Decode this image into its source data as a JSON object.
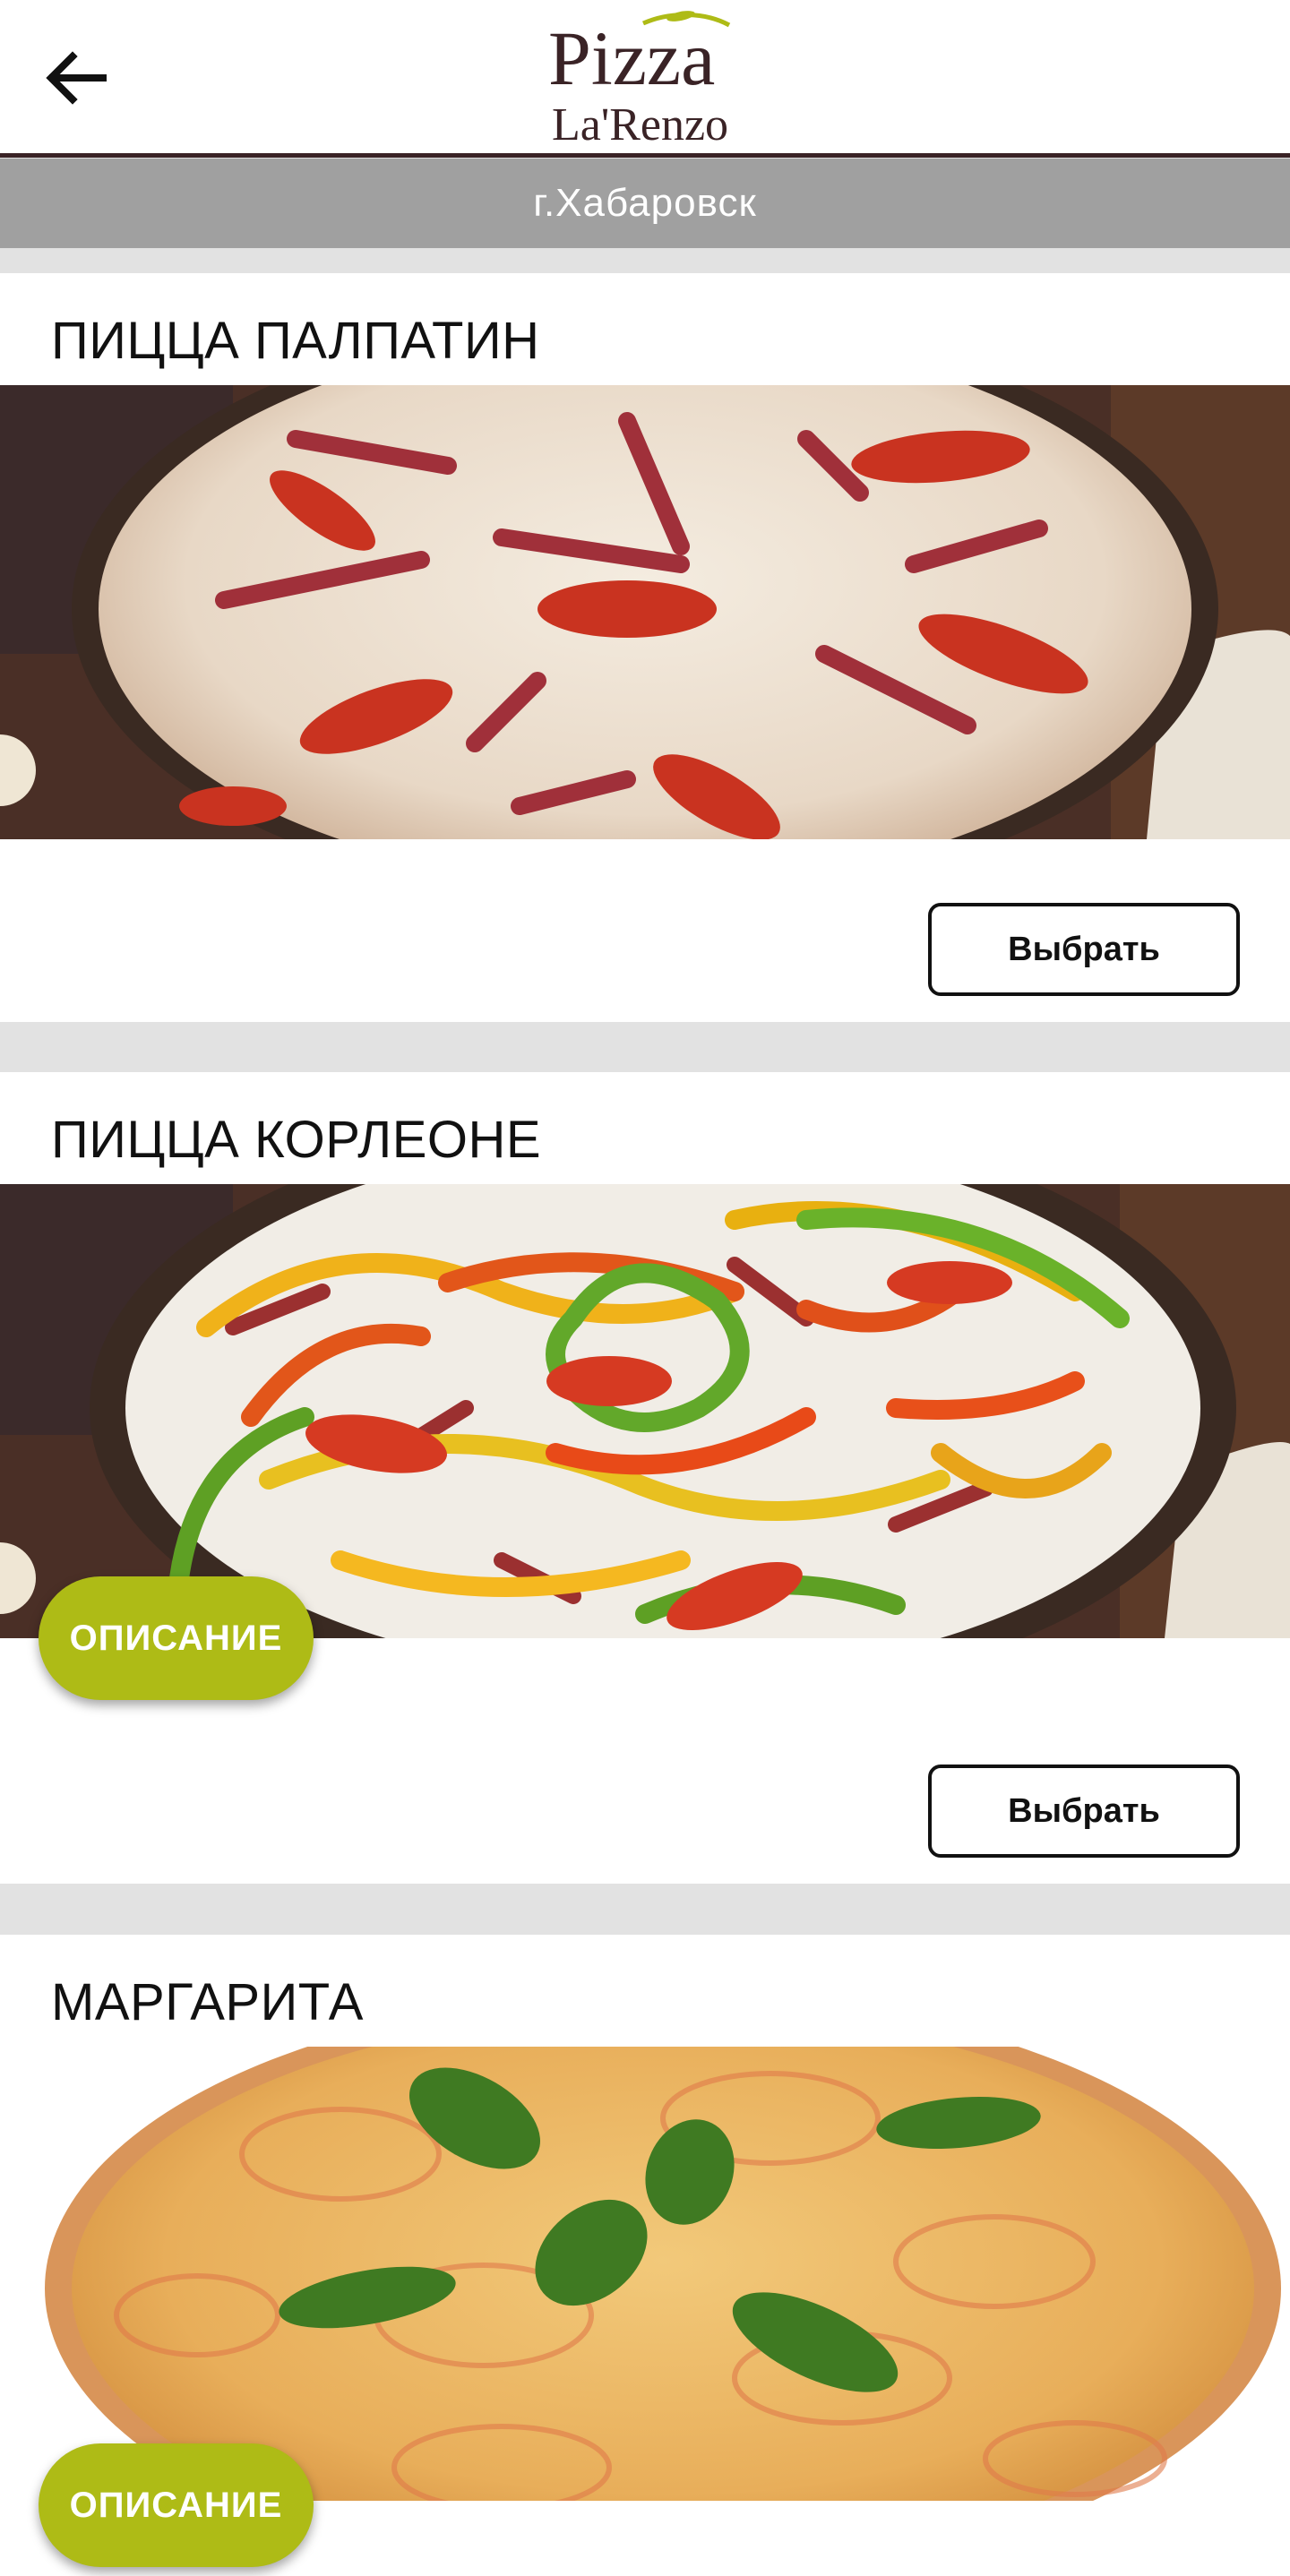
{
  "header": {
    "logo_top": "Pizza",
    "logo_bottom": "La'Renzo",
    "back_icon": "arrow-left-icon"
  },
  "city_bar": {
    "label": "г.Хабаровск"
  },
  "products": [
    {
      "title": "ПИЦЦА ПАЛПАТИН",
      "select_label": "Выбрать",
      "image": "pizza-palpatin-photo"
    },
    {
      "title": "ПИЦЦА КОРЛЕОНЕ",
      "select_label": "Выбрать",
      "description_label": "ОПИСАНИЕ",
      "image": "pizza-corleone-photo"
    },
    {
      "title": "МАРГАРИТА",
      "description_label": "ОПИСАНИЕ",
      "image": "pizza-margarita-photo"
    }
  ],
  "colors": {
    "header_border": "#3a2326",
    "city_bar": "#a0a0a0",
    "accent_green": "#aebb16",
    "logo_brown": "#3a2326"
  }
}
